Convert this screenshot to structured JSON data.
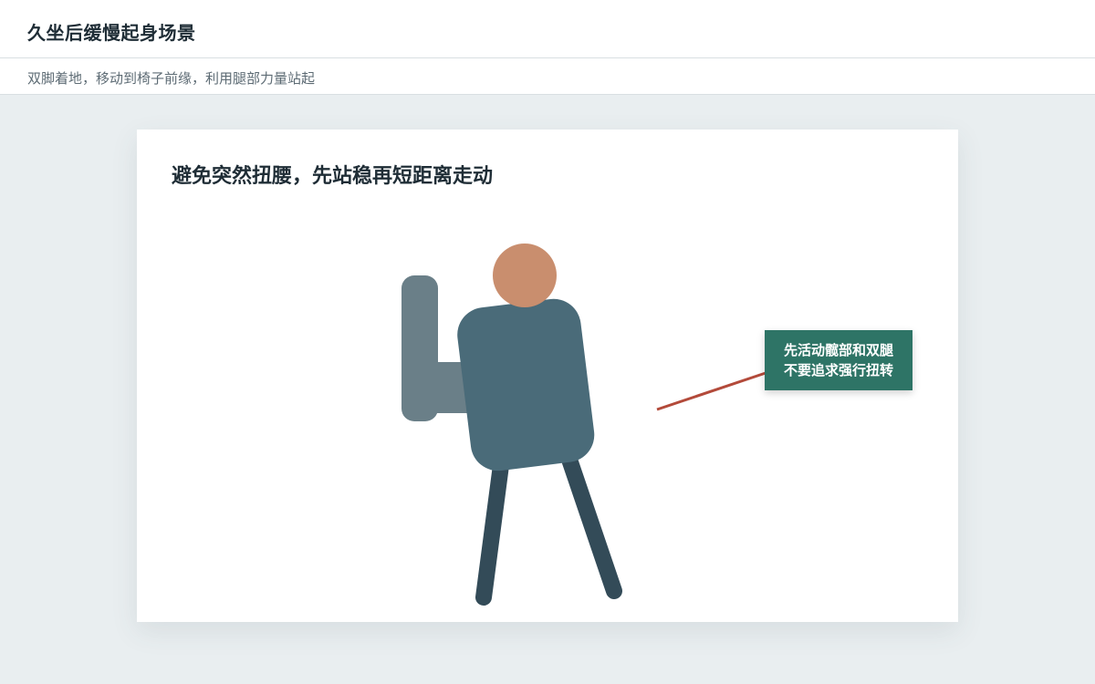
{
  "header": {
    "title": "久坐后缓慢起身场景"
  },
  "subheader": {
    "text": "双脚着地，移动到椅子前缘，利用腿部力量站起"
  },
  "card": {
    "title": "避免突然扭腰，先站稳再短距离走动",
    "callout": {
      "line1": "先活动髋部和双腿",
      "line2": "不要追求强行扭转"
    }
  },
  "colors": {
    "background": "#e9eef0",
    "skin": "#c98e6e",
    "torso": "#4a6b79",
    "legs": "#334b58",
    "chair": "#6a7f88",
    "pointer_line": "#b34a3a",
    "callout_bg": "#2e7466"
  }
}
